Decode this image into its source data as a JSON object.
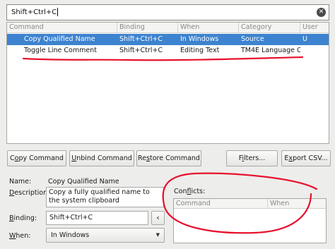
{
  "filter": {
    "value": "Shift+Ctrl+C",
    "clear_icon": "clear-icon"
  },
  "table": {
    "columns": [
      "Command",
      "Binding",
      "When",
      "Category",
      "User"
    ],
    "rows": [
      {
        "command": "Copy Qualified Name",
        "binding": "Shift+Ctrl+C",
        "when": "In Windows",
        "category": "Source",
        "user": "U",
        "selected": true
      },
      {
        "command": "Toggle Line Comment",
        "binding": "Shift+Ctrl+C",
        "when": "Editing Text",
        "category": "TM4E Language Co",
        "user": "",
        "selected": false
      }
    ]
  },
  "buttons": {
    "copy_pre": "C",
    "copy_u": "o",
    "copy_post": "py Command",
    "unbind_u": "U",
    "unbind_post": "nbind Command",
    "restore_pre": "Re",
    "restore_u": "s",
    "restore_post": "tore Command",
    "filters_pre": "F",
    "filters_u": "i",
    "filters_post": "lters...",
    "export_pre": "E",
    "export_u": "x",
    "export_post": "port CSV..."
  },
  "details": {
    "name_label": "Name:",
    "name_value": "Copy Qualified Name",
    "desc_pre": "",
    "desc_u": "D",
    "desc_post": "escription:",
    "desc_value": "Copy a fully qualified name to the system clipboard",
    "binding_pre": "",
    "binding_u": "B",
    "binding_post": "inding:",
    "binding_value": "Shift+Ctrl+C",
    "binding_arrow": "‹",
    "when_pre": "",
    "when_u": "W",
    "when_post": "hen:",
    "when_value": "In Windows",
    "conflicts_pre": "Con",
    "conflicts_u": "f",
    "conflicts_post": "licts:",
    "conflict_columns": [
      "Command",
      "When"
    ]
  },
  "annotation_color": "#e8112d"
}
